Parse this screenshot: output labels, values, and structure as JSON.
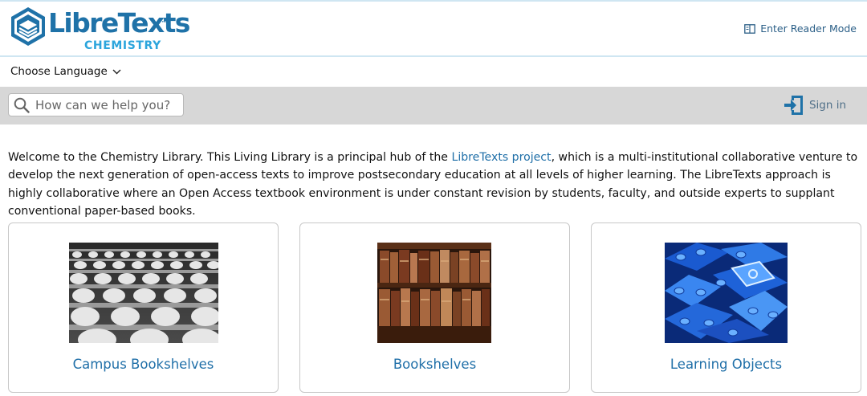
{
  "header": {
    "logo_word": "LibreTexts",
    "logo_tm": "™",
    "logo_sub": "CHEMISTRY",
    "reader_mode_label": "Enter Reader Mode"
  },
  "language": {
    "label": "Choose Language"
  },
  "search": {
    "placeholder": "How can we help you?"
  },
  "account": {
    "signin_label": "Sign in"
  },
  "intro": {
    "part1": "Welcome to the Chemistry Library. This Living Library is a principal hub of the ",
    "link_text": "LibreTexts project",
    "part2": ", which is a multi-institutional collaborative venture to develop the next generation of open-access texts to improve postsecondary education at all levels of higher learning. The LibreTexts approach is highly collaborative where an Open Access textbook environment is under constant revision by students, faculty, and outside experts to supplant conventional paper-based books."
  },
  "cards": [
    {
      "label": "Campus Bookshelves",
      "image": "lecture-hall-seats-photo"
    },
    {
      "label": "Bookshelves",
      "image": "old-books-shelf-photo"
    },
    {
      "label": "Learning Objects",
      "image": "blue-lego-bricks-photo"
    }
  ],
  "colors": {
    "brand": "#1f72a8",
    "brand_light": "#2ca5dc",
    "link": "#1f6fa8",
    "search_bar_bg": "#d7d7d7"
  }
}
